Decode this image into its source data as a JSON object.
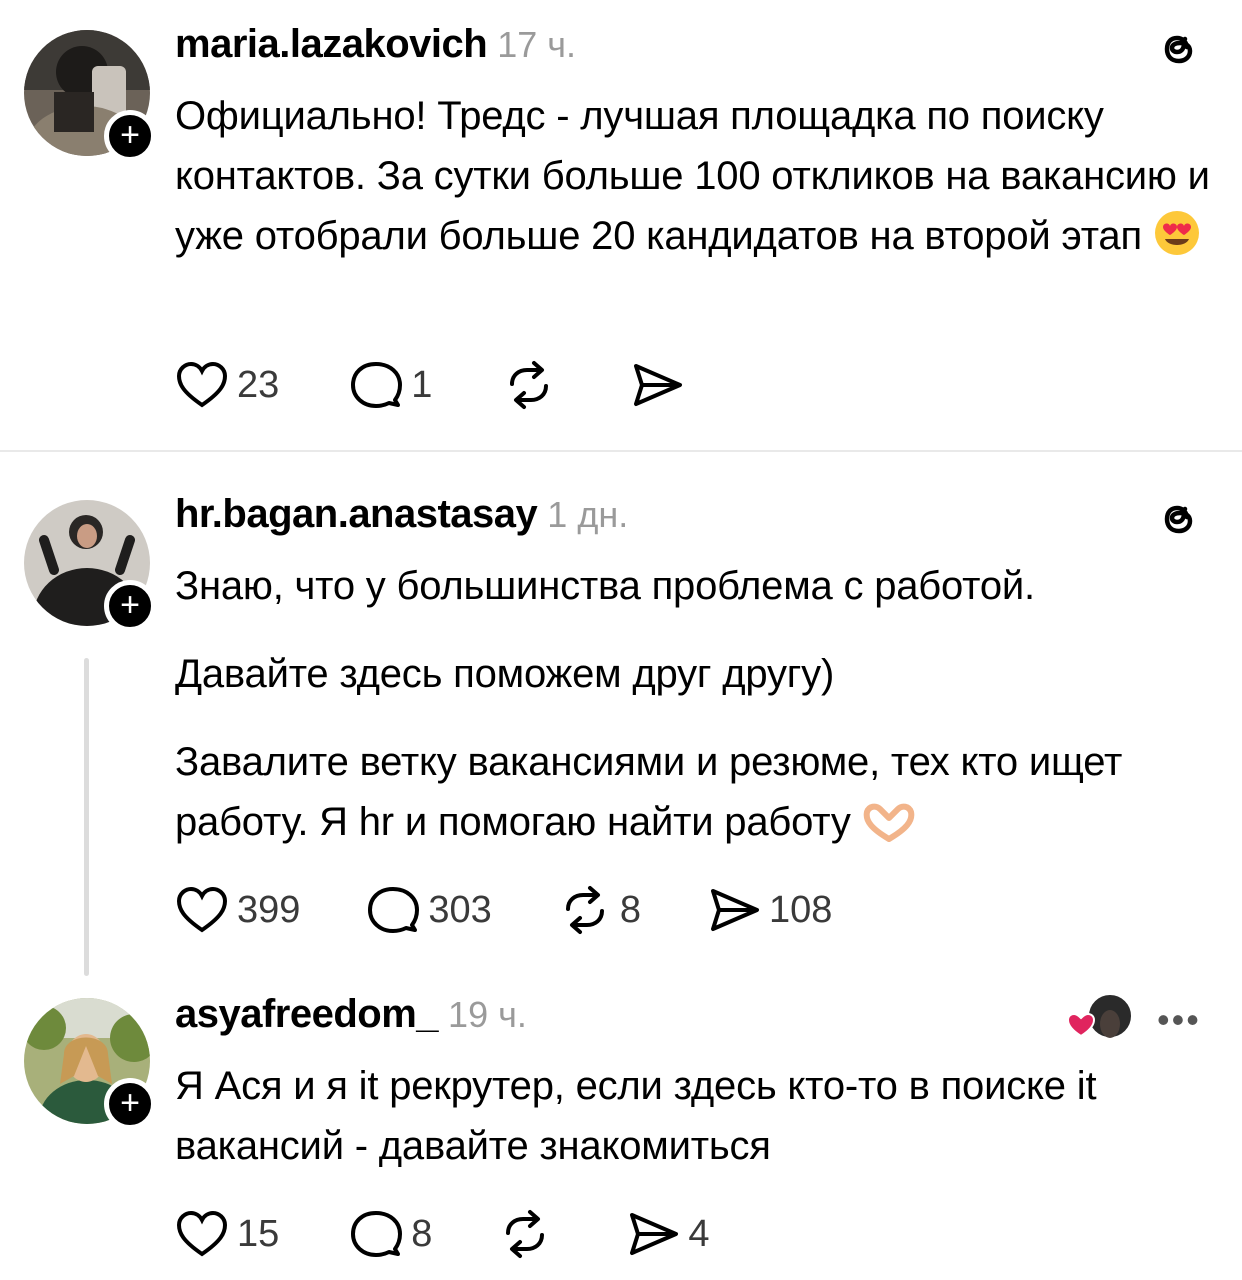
{
  "posts": [
    {
      "username": "maria.lazakovich",
      "time": "17 ч.",
      "paragraphs": [
        "Официально! Тредс - лучшая площадка по поиску контактов. За сутки больше 100 откликов на вакансию и уже отобрали больше 20 кандидатов на второй этап"
      ],
      "likes": "23",
      "replies": "1",
      "reposts": "",
      "shares": ""
    },
    {
      "username": "hr.bagan.anastasay",
      "time": "1 дн.",
      "paragraphs": [
        "Знаю, что у большинства проблема с работой.",
        "Давайте здесь поможем друг другу)",
        "Завалите ветку вакансиями и резюме, тех кто ищет работу. Я hr и помогаю найти работу"
      ],
      "likes": "399",
      "replies": "303",
      "reposts": "8",
      "shares": "108"
    },
    {
      "username": "asyafreedom_",
      "time": "19 ч.",
      "paragraphs": [
        "Я Ася и я it рекрутер, если здесь кто-то в поиске it вакансий - давайте знакомиться"
      ],
      "likes": "15",
      "replies": "8",
      "reposts": "",
      "shares": "4"
    }
  ],
  "icons": {
    "like": "heart-icon",
    "reply": "speech-bubble-icon",
    "repost": "repost-icon",
    "share": "send-icon",
    "threads": "threads-logo-icon",
    "follow": "plus-icon",
    "more": "ellipsis-icon"
  },
  "colors": {
    "text": "#000000",
    "muted": "#9a9a9a",
    "divider": "#e9e9e9",
    "like_heart": "#e0245e"
  },
  "follow_symbol": "+",
  "more_symbol": "•••"
}
